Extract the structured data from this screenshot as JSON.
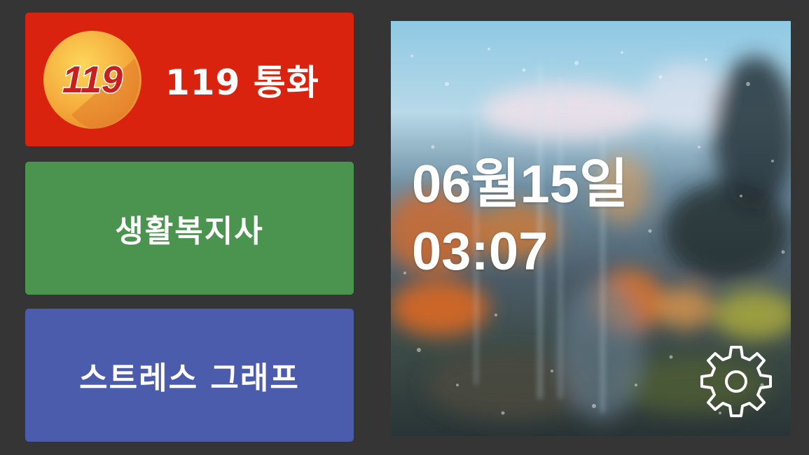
{
  "tiles": {
    "call": {
      "label": "119 통화",
      "logo_text": "119",
      "color": "#d9230f",
      "icon": "emergency-119-logo"
    },
    "welfare": {
      "label": "생활복지사",
      "color": "#4a944f"
    },
    "stress": {
      "label": "스트레스 그래프",
      "color": "#4b5cad"
    }
  },
  "clock": {
    "date": "06월15일",
    "time": "03:07"
  },
  "settings": {
    "icon": "gear-icon"
  }
}
